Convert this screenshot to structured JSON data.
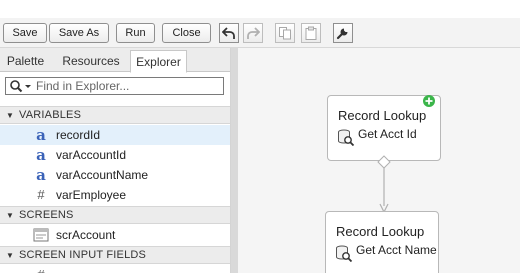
{
  "toolbar": {
    "buttons": {
      "save": "Save",
      "save_as": "Save As",
      "run": "Run",
      "close": "Close"
    },
    "icons": [
      "undo-icon",
      "redo-icon",
      "copy-icon",
      "paste-icon",
      "wrench-icon"
    ]
  },
  "left_panel": {
    "tabs": [
      "Palette",
      "Resources",
      "Explorer"
    ],
    "active_tab": "Explorer",
    "search": {
      "placeholder": "Find in Explorer...",
      "value": ""
    },
    "sections": [
      {
        "title": "VARIABLES",
        "items": [
          {
            "label": "recordId",
            "icon": "text-variable-icon",
            "selected": true
          },
          {
            "label": "varAccountId",
            "icon": "text-variable-icon"
          },
          {
            "label": "varAccountName",
            "icon": "text-variable-icon"
          },
          {
            "label": "varEmployee",
            "icon": "number-variable-icon"
          }
        ]
      },
      {
        "title": "SCREENS",
        "items": [
          {
            "label": "scrAccount",
            "icon": "screen-icon"
          }
        ]
      },
      {
        "title": "SCREEN INPUT FIELDS",
        "items": []
      }
    ]
  },
  "canvas": {
    "nodes": [
      {
        "type": "Record Lookup",
        "label": "Get Acct Id",
        "icon": "record-lookup-icon",
        "start": true
      },
      {
        "type": "Record Lookup",
        "label": "Get Acct Name",
        "icon": "record-lookup-icon"
      }
    ]
  },
  "colors": {
    "selected_row": "#e3f0fb",
    "start_badge": "#3bb54a",
    "variable_icon": "#3b63b8"
  }
}
